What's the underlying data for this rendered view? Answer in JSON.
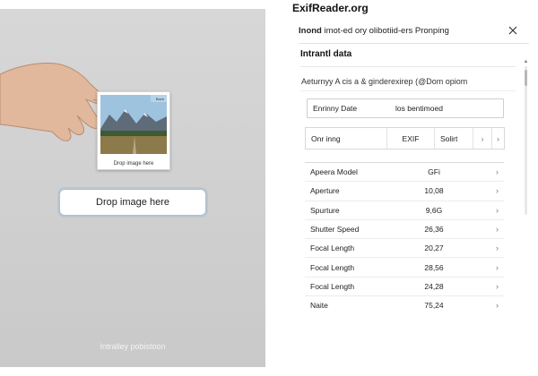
{
  "dropzone": {
    "photo_tag": "Bach",
    "photo_caption": "Drop image here",
    "button_label": "Drop image here",
    "footer_text": "Intralley pobistoon"
  },
  "header": {
    "site_title": "ExifReader.org"
  },
  "dialog": {
    "title_bold": "Inond",
    "title_rest": " imot-ed ory olibotiid-ers Pronping",
    "close_icon": "close-icon"
  },
  "section": {
    "title": "Intrantl data",
    "description": "Aeturnyy A cis a & ginderexirep (@Dom opiom"
  },
  "date_row": {
    "label": "Enrinny Date",
    "value": "los bentimoed"
  },
  "sort_row": {
    "col1": "Onr inng",
    "col2": "EXIF",
    "col3": "Solirt",
    "col4": "›",
    "col5": "›"
  },
  "rows": [
    {
      "key": "Apeera Model",
      "value": "GFi"
    },
    {
      "key": "Aperture",
      "value": "10,08"
    },
    {
      "key": "Spurture",
      "value": "9,6G"
    },
    {
      "key": "Shutter Speed",
      "value": "26,36"
    },
    {
      "key": "Focal Length",
      "value": "20,27"
    },
    {
      "key": "Focal Length",
      "value": "28,56"
    },
    {
      "key": "Focal Length",
      "value": "24,28"
    },
    {
      "key": "Naite",
      "value": "75,24"
    }
  ],
  "colors": {
    "panel_gray": "#d0d0d0",
    "button_border": "#a9c0d6",
    "text_dark": "#222222"
  }
}
